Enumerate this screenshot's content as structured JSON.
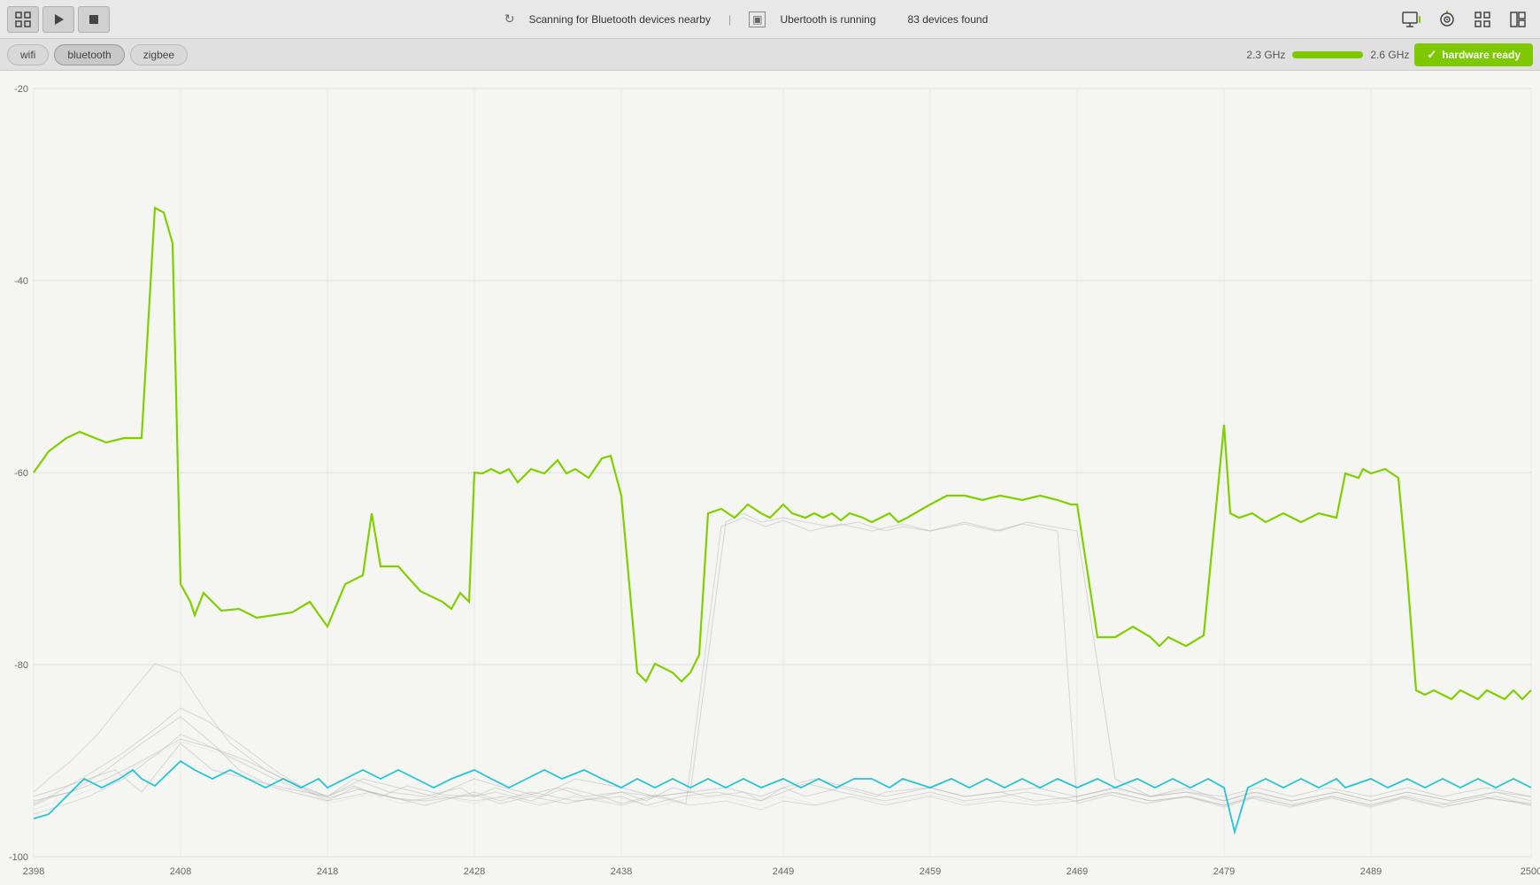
{
  "toolbar": {
    "grid_btn_label": "⊞",
    "play_btn_label": "▶",
    "stop_btn_label": "■",
    "scanning_text": "Scanning for Bluetooth devices nearby",
    "divider": "|",
    "ubertooth_icon": "⊟",
    "ubertooth_text": "Ubertooth is running",
    "devices_found": "83 devices found",
    "monitor_icon": "⊡",
    "antenna_icon": "◎",
    "grid_icon2": "⊞",
    "split_icon": "⊟"
  },
  "tabs": {
    "wifi_label": "wifi",
    "bluetooth_label": "bluetooth",
    "zigbee_label": "zigbee",
    "freq_low": "2.3 GHz",
    "freq_high": "2.6 GHz",
    "hardware_ready": "hardware ready"
  },
  "chart": {
    "y_labels": [
      "-20",
      "-40",
      "-60",
      "-80",
      "-100"
    ],
    "y_values": [
      -20,
      -40,
      -60,
      -80,
      -100
    ],
    "x_labels": [
      "2398",
      "2408",
      "2418",
      "2428",
      "2438",
      "2449",
      "2459",
      "2469",
      "2479",
      "2489",
      "2500"
    ],
    "colors": {
      "green_line": "#80d000",
      "blue_line": "#00bcd4",
      "gray_line": "#aaaaaa",
      "grid_line": "#dddddd",
      "background": "#f5f5f2"
    }
  }
}
